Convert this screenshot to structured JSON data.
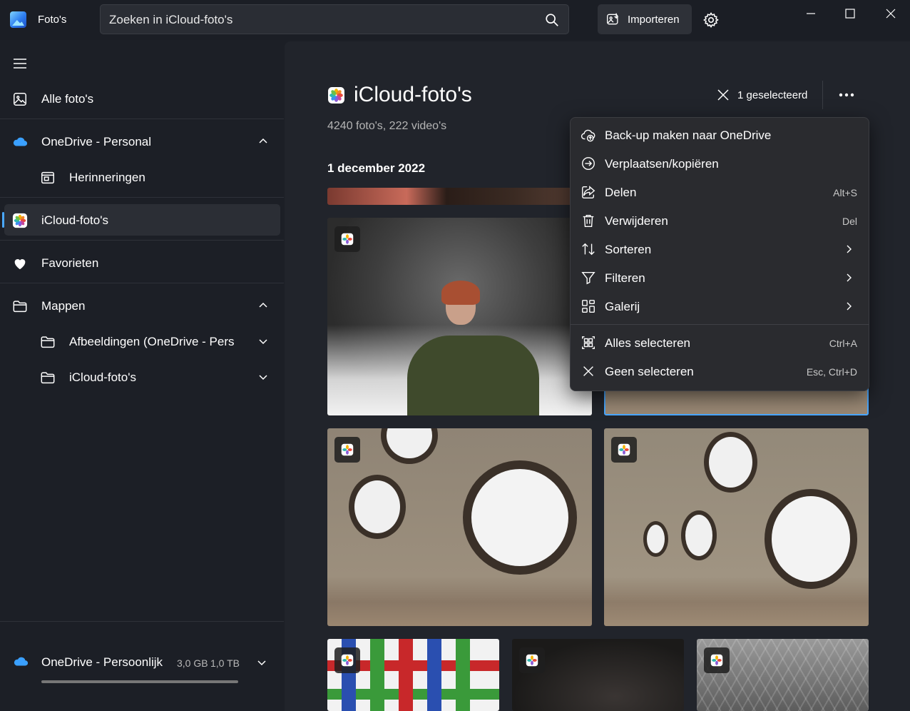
{
  "app": {
    "title": "Foto's"
  },
  "search": {
    "placeholder": "Zoeken in iCloud-foto's"
  },
  "toolbar": {
    "import_label": "Importeren"
  },
  "sidebar": {
    "items": [
      {
        "label": "Alle foto's"
      },
      {
        "label": "OneDrive - Personal"
      },
      {
        "label": "Herinneringen"
      },
      {
        "label": "iCloud-foto's"
      },
      {
        "label": "Favorieten"
      },
      {
        "label": "Mappen"
      },
      {
        "label": "Afbeeldingen (OneDrive - Pers"
      },
      {
        "label": "iCloud-foto's"
      }
    ],
    "storage": {
      "label": "OneDrive - Persoonlijk",
      "used": "3,0 GB",
      "total": "1,0 TB"
    }
  },
  "content": {
    "title": "iCloud-foto's",
    "counts": "4240 foto's, 222 video's",
    "date": "1 december 2022",
    "selection": "1 geselecteerd"
  },
  "menu": {
    "items": [
      {
        "label": "Back-up maken naar OneDrive",
        "shortcut": ""
      },
      {
        "label": "Verplaatsen/kopiëren",
        "shortcut": ""
      },
      {
        "label": "Delen",
        "shortcut": "Alt+S"
      },
      {
        "label": "Verwijderen",
        "shortcut": "Del"
      },
      {
        "label": "Sorteren",
        "shortcut": ""
      },
      {
        "label": "Filteren",
        "shortcut": ""
      },
      {
        "label": "Galerij",
        "shortcut": ""
      },
      {
        "label": "Alles selecteren",
        "shortcut": "Ctrl+A"
      },
      {
        "label": "Geen selecteren",
        "shortcut": "Esc, Ctrl+D"
      }
    ]
  },
  "colors": {
    "accent": "#4aa8ff",
    "background": "#1c1f26",
    "content_bg": "#21242b",
    "menu_bg": "#2a2b2f"
  }
}
